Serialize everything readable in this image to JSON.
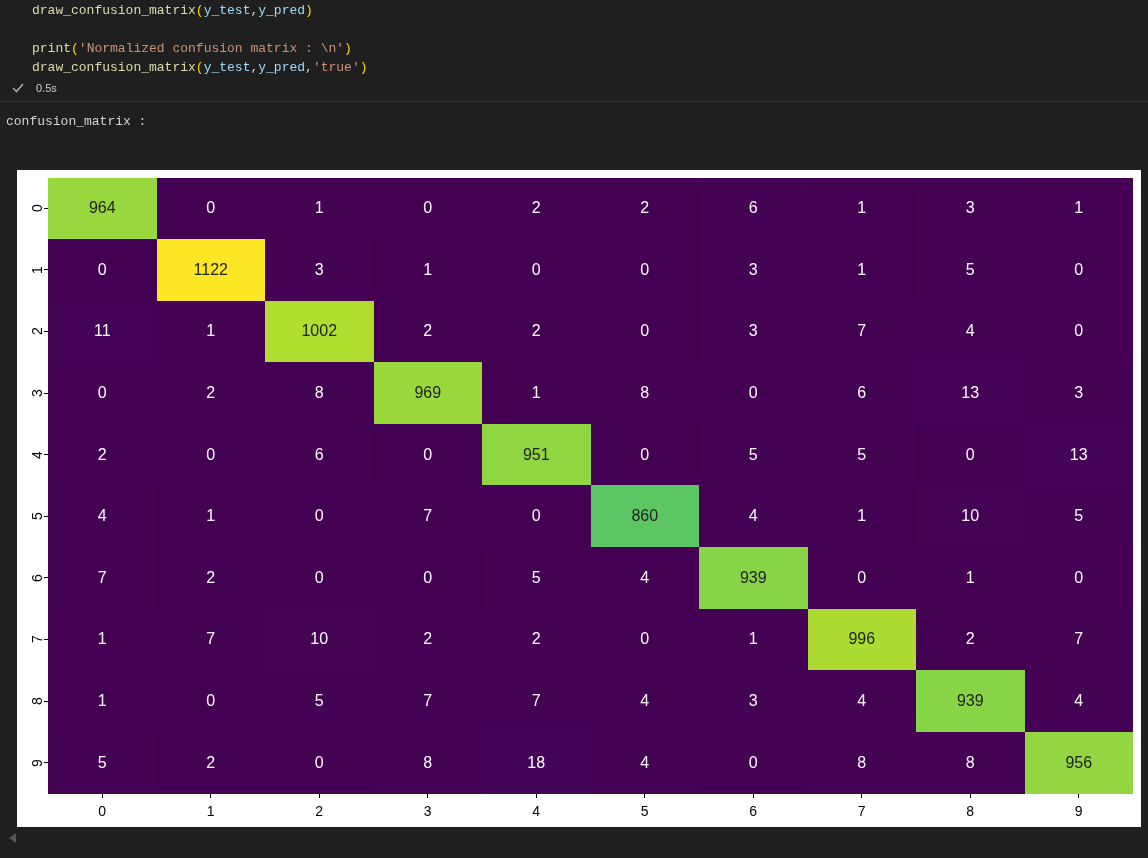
{
  "code_cell": {
    "blocks": [
      [
        {
          "tokens": [
            {
              "kind": "function",
              "text": "draw_confusion_matrix"
            },
            {
              "kind": "bracket",
              "text": "("
            },
            {
              "kind": "variable",
              "text": "y_test"
            },
            {
              "kind": "plain",
              "text": ","
            },
            {
              "kind": "variable",
              "text": "y_pred"
            },
            {
              "kind": "bracket",
              "text": ")"
            }
          ]
        }
      ],
      [
        {
          "tokens": [
            {
              "kind": "function",
              "text": "print"
            },
            {
              "kind": "bracket",
              "text": "("
            },
            {
              "kind": "string",
              "text": "'Normalized confusion matrix : \\n'"
            },
            {
              "kind": "bracket",
              "text": ")"
            }
          ]
        },
        {
          "tokens": [
            {
              "kind": "function",
              "text": "draw_confusion_matrix"
            },
            {
              "kind": "bracket",
              "text": "("
            },
            {
              "kind": "variable",
              "text": "y_test"
            },
            {
              "kind": "plain",
              "text": ","
            },
            {
              "kind": "variable",
              "text": "y_pred"
            },
            {
              "kind": "plain",
              "text": ","
            },
            {
              "kind": "string",
              "text": "'true'"
            },
            {
              "kind": "bracket",
              "text": ")"
            }
          ]
        }
      ]
    ],
    "status": {
      "succeeded": true,
      "duration": "0.5s"
    }
  },
  "output": {
    "text": "confusion_matrix :",
    "heatmap": {
      "x_labels": [
        "0",
        "1",
        "2",
        "3",
        "4",
        "5",
        "6",
        "7",
        "8",
        "9"
      ],
      "y_labels": [
        "0",
        "1",
        "2",
        "3",
        "4",
        "5",
        "6",
        "7",
        "8",
        "9"
      ],
      "rows": [
        [
          "964",
          "0",
          "1",
          "0",
          "2",
          "2",
          "6",
          "1",
          "3",
          "1"
        ],
        [
          "0",
          "1122",
          "3",
          "1",
          "0",
          "0",
          "3",
          "1",
          "5",
          "0"
        ],
        [
          "11",
          "1",
          "1002",
          "2",
          "2",
          "0",
          "3",
          "7",
          "4",
          "0"
        ],
        [
          "0",
          "2",
          "8",
          "969",
          "1",
          "8",
          "0",
          "6",
          "13",
          "3"
        ],
        [
          "2",
          "0",
          "6",
          "0",
          "951",
          "0",
          "5",
          "5",
          "0",
          "13"
        ],
        [
          "4",
          "1",
          "0",
          "7",
          "0",
          "860",
          "4",
          "1",
          "10",
          "5"
        ],
        [
          "7",
          "2",
          "0",
          "0",
          "5",
          "4",
          "939",
          "0",
          "1",
          "0"
        ],
        [
          "1",
          "7",
          "10",
          "2",
          "2",
          "0",
          "1",
          "996",
          "2",
          "7"
        ],
        [
          "1",
          "0",
          "5",
          "7",
          "7",
          "4",
          "3",
          "4",
          "939",
          "4"
        ],
        [
          "5",
          "2",
          "0",
          "8",
          "18",
          "4",
          "0",
          "8",
          "8",
          "956"
        ]
      ]
    }
  }
}
